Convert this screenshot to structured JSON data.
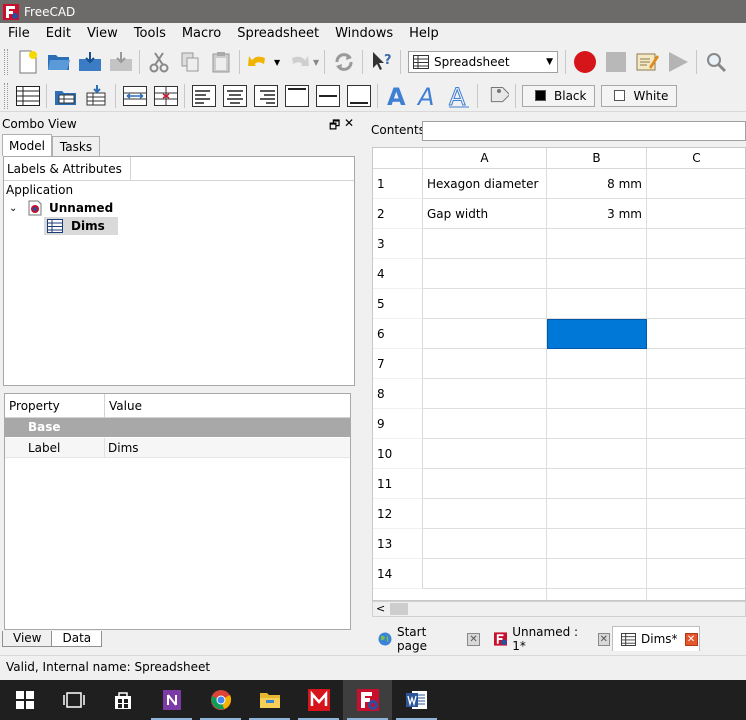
{
  "window": {
    "title": "FreeCAD"
  },
  "menu": [
    "File",
    "Edit",
    "View",
    "Tools",
    "Macro",
    "Spreadsheet",
    "Windows",
    "Help"
  ],
  "workbench": {
    "selected": "Spreadsheet"
  },
  "toolbar2": {
    "color_black": "Black",
    "color_white": "White"
  },
  "combo": {
    "title": "Combo View",
    "float_glyph": "🗗",
    "close_glyph": "✕",
    "tabs": [
      "Model",
      "Tasks"
    ],
    "tree_header": "Labels & Attributes",
    "tree": {
      "root": "Application",
      "doc": "Unnamed",
      "item": "Dims",
      "expand_glyph": "⌄"
    },
    "props": {
      "col_property": "Property",
      "col_value": "Value",
      "group": "Base",
      "row_name": "Label",
      "row_value": "Dims"
    },
    "bottom_tabs": [
      "View",
      "Data"
    ]
  },
  "sheet": {
    "contents_label": "Contents",
    "columns": [
      "A",
      "B",
      "C"
    ],
    "rows": [
      "1",
      "2",
      "3",
      "4",
      "5",
      "6",
      "7",
      "8",
      "9",
      "10",
      "11",
      "12",
      "13",
      "14"
    ],
    "cells": {
      "A1": "Hexagon diameter",
      "B1": "8 mm",
      "A2": "Gap width",
      "B2": "3 mm"
    },
    "selected_cell": "B6",
    "scroll_left_glyph": "<"
  },
  "doc_tabs": [
    {
      "label": "Start page"
    },
    {
      "label": "Unnamed : 1*"
    },
    {
      "label": "Dims*"
    }
  ],
  "status": "Valid, Internal name: Spreadsheet",
  "taskbar_apps": [
    "windows-start",
    "task-view",
    "store",
    "onenote-app",
    "chrome",
    "file-explorer",
    "m-app",
    "freecad",
    "word"
  ],
  "colors": {
    "selection": "#0078d7",
    "titlebar": "#6d6a6a",
    "close_tab": "#e4572e"
  }
}
